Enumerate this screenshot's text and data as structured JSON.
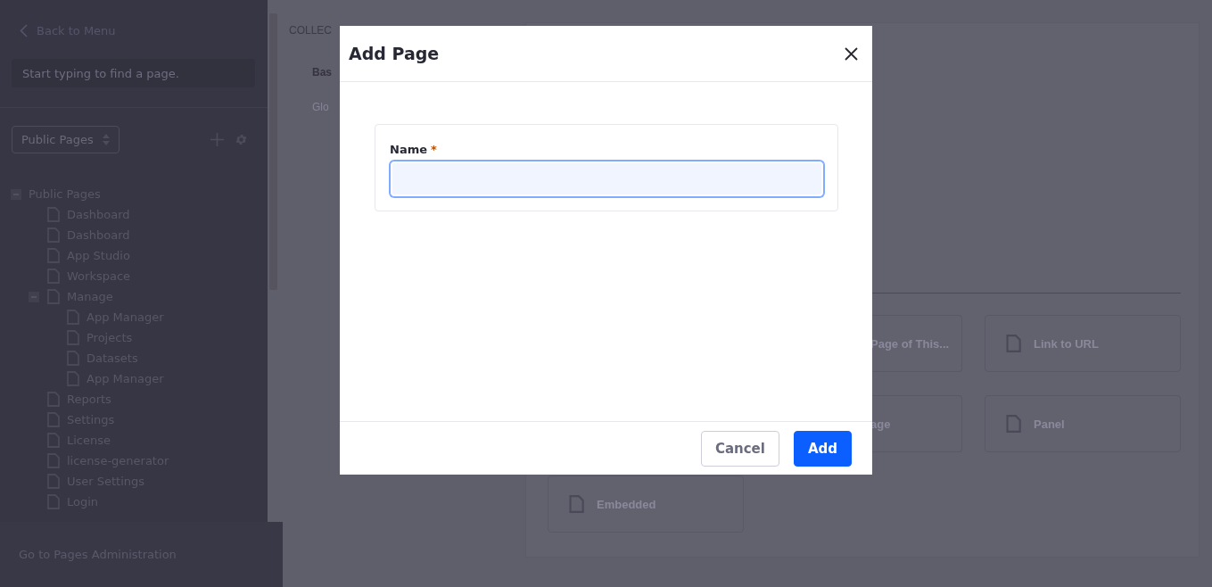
{
  "sidebar": {
    "back_link": "Back to Menu",
    "search": {
      "placeholder": "Start typing to find a page."
    },
    "site_select": "Public Pages",
    "tree": [
      {
        "label": "Public Pages",
        "expanded": true,
        "children": [
          {
            "label": "Dashboard"
          },
          {
            "label": "Dashboard"
          },
          {
            "label": "App Studio"
          },
          {
            "label": "Workspace"
          },
          {
            "label": "Manage",
            "expanded": true,
            "children": [
              {
                "label": "App Manager"
              },
              {
                "label": "Projects"
              },
              {
                "label": "Datasets"
              },
              {
                "label": "App Manager"
              }
            ]
          },
          {
            "label": "Reports"
          },
          {
            "label": "Settings"
          },
          {
            "label": "License"
          },
          {
            "label": "license-generator"
          },
          {
            "label": "User Settings"
          },
          {
            "label": "Login"
          }
        ]
      }
    ],
    "footer_link": "Go to Pages Administration"
  },
  "main": {
    "heading": "COLLEC",
    "nav": [
      {
        "label": "Bas",
        "selected": true
      },
      {
        "label": "Glo",
        "selected": false
      }
    ],
    "cards": [
      {
        "label": "Page of This...",
        "kind": "clipped"
      },
      {
        "label": "Link to URL",
        "kind": "full"
      },
      {
        "label": "age",
        "kind": "clipped"
      },
      {
        "label": "Panel",
        "kind": "full"
      },
      {
        "label": "Embedded",
        "kind": "full"
      }
    ]
  },
  "modal": {
    "title": "Add Page",
    "field": {
      "label": "Name",
      "required_mark": "*",
      "focused": true
    },
    "buttons": [
      {
        "label": "Cancel",
        "kind": "secondary"
      },
      {
        "label": "Add",
        "kind": "primary"
      }
    ]
  }
}
